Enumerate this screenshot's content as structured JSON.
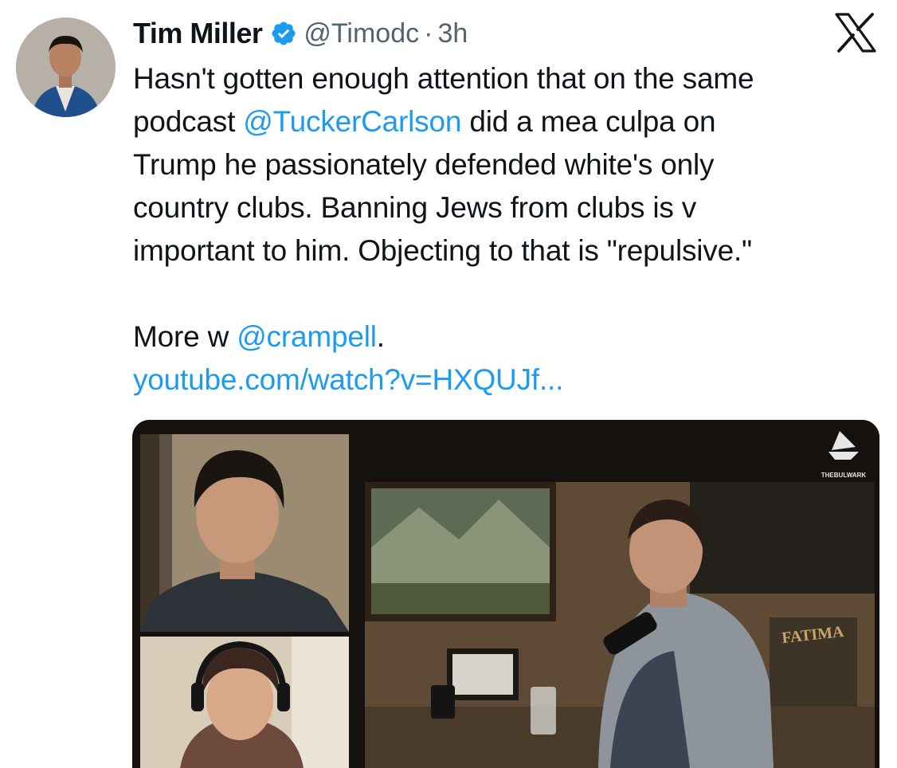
{
  "tweet": {
    "author_name": "Tim Miller",
    "handle": "@Timodc",
    "separator": "·",
    "time": "3h",
    "lines": {
      "l1": "Hasn't gotten enough attention that on the same",
      "l2_a": "podcast ",
      "l2_mention": "@TuckerCarlson",
      "l2_b": " did a mea culpa on",
      "l3": "Trump he passionately defended white's only",
      "l4": "country clubs. Banning Jews from clubs is v",
      "l5": "important to him. Objecting to that is \"repulsive.\"",
      "l6_a": "More w ",
      "l6_mention": "@crampell",
      "l6_b": ".",
      "link": "youtube.com/watch?v=HXQUJf..."
    }
  },
  "media": {
    "watermark": "THEBULWARK",
    "poster_text": "FATIMA"
  },
  "icons": {
    "verified": "verified-badge-icon",
    "close": "x-logo-icon"
  },
  "colors": {
    "link": "#1d9bf0",
    "verified": "#1d9bf0",
    "secondary": "#536471"
  }
}
